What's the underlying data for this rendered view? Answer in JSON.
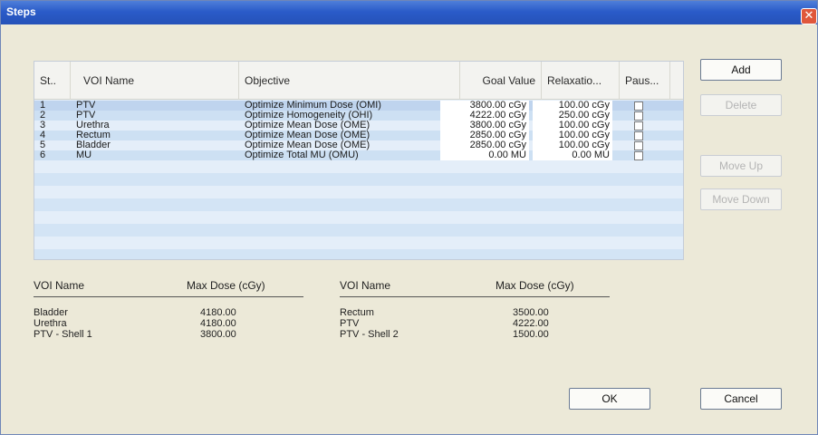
{
  "window": {
    "title": "Steps",
    "close_icon": "close-icon",
    "close_glyph": "✕"
  },
  "table": {
    "headers": {
      "step": "St..",
      "voi": "VOI Name",
      "objective": "Objective",
      "goal": "Goal Value",
      "relax": "Relaxatio...",
      "paused": "Paus..."
    },
    "rows": [
      {
        "step": "1",
        "voi": "PTV",
        "objective": "Optimize Minimum Dose (OMI)",
        "goal": "3800.00 cGy",
        "relax": "100.00 cGy",
        "paused": false
      },
      {
        "step": "2",
        "voi": "PTV",
        "objective": "Optimize Homogeneity (OHI)",
        "goal": "4222.00 cGy",
        "relax": "250.00 cGy",
        "paused": false
      },
      {
        "step": "3",
        "voi": "Urethra",
        "objective": "Optimize Mean Dose (OME)",
        "goal": "3800.00 cGy",
        "relax": "100.00 cGy",
        "paused": false
      },
      {
        "step": "4",
        "voi": "Rectum",
        "objective": "Optimize Mean Dose (OME)",
        "goal": "2850.00 cGy",
        "relax": "100.00 cGy",
        "paused": false
      },
      {
        "step": "5",
        "voi": "Bladder",
        "objective": "Optimize Mean Dose (OME)",
        "goal": "2850.00 cGy",
        "relax": "100.00 cGy",
        "paused": false
      },
      {
        "step": "6",
        "voi": "MU",
        "objective": "Optimize Total MU (OMU)",
        "goal": "0.00 MU",
        "relax": "0.00 MU",
        "paused": false
      }
    ]
  },
  "buttons": {
    "add": "Add",
    "delete": "Delete",
    "move_up": "Move Up",
    "move_down": "Move Down",
    "ok": "OK",
    "cancel": "Cancel"
  },
  "summary": {
    "left": {
      "header_voi": "VOI Name",
      "header_dose": "Max Dose (cGy)",
      "rows": [
        {
          "voi": "Bladder",
          "dose": "4180.00"
        },
        {
          "voi": "Urethra",
          "dose": "4180.00"
        },
        {
          "voi": "PTV - Shell 1",
          "dose": "3800.00"
        }
      ]
    },
    "right": {
      "header_voi": "VOI Name",
      "header_dose": "Max Dose (cGy)",
      "rows": [
        {
          "voi": "Rectum",
          "dose": "3500.00"
        },
        {
          "voi": "PTV",
          "dose": "4222.00"
        },
        {
          "voi": "PTV - Shell 2",
          "dose": "1500.00"
        }
      ]
    }
  }
}
